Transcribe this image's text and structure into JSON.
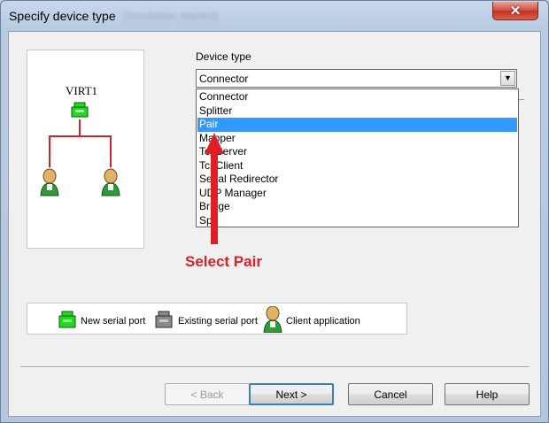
{
  "window": {
    "title": "Specify device type",
    "title_ghost": "(Insulation started)",
    "close_icon": "close-x-icon",
    "close_glyph": "✕"
  },
  "diagram": {
    "node_label": "VIRT1",
    "icons": [
      "new-serial-port-icon",
      "client-application-icon",
      "client-application-icon"
    ]
  },
  "device_type": {
    "label": "Device type",
    "selected_value": "Connector",
    "dropdown_glyph": "▼",
    "options": [
      "Connector",
      "Splitter",
      "Pair",
      "Mapper",
      "TcpServer",
      "TcpClient",
      "Serial Redirector",
      "UDP Manager",
      "Bridge",
      "Spy"
    ],
    "highlighted_index": 2
  },
  "annotation": {
    "text": "Select Pair",
    "color": "#d62428"
  },
  "legend": {
    "new_port": "New serial port",
    "existing_port": "Existing serial port",
    "client_app": "Client application"
  },
  "buttons": {
    "back": "< Back",
    "next": "Next >",
    "cancel": "Cancel",
    "help": "Help"
  },
  "colors": {
    "new_port": "#22d822",
    "existing_port": "#8a8a8a",
    "client": "#e0b060",
    "line": "#c8262b",
    "selection": "#3399ff"
  }
}
